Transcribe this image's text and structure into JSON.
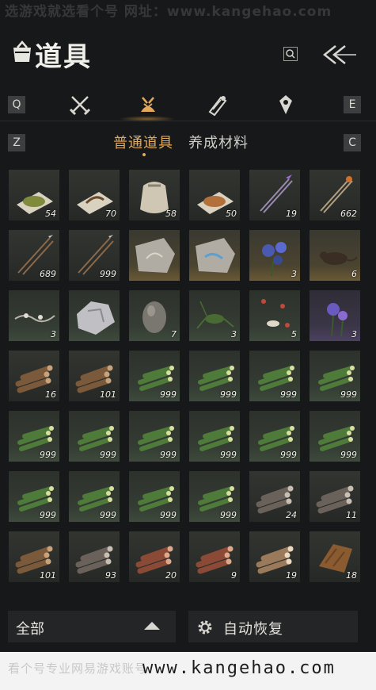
{
  "watermark_top": "选游戏就选看个号   网址：www.kangehao.com",
  "header": {
    "title": "道具"
  },
  "category_keys": {
    "left": "Q",
    "right": "E",
    "sub_left": "Z",
    "sub_right": "C"
  },
  "category_icons": [
    "crossed-swords-icon",
    "bundle-icon",
    "scroll-icon",
    "gem-icon"
  ],
  "subtabs": [
    "普通道具",
    "养成材料"
  ],
  "items": [
    {
      "kind": "herb-powder",
      "qty": "54",
      "bg": "plain"
    },
    {
      "kind": "hook-rope",
      "qty": "70",
      "bg": "plain"
    },
    {
      "kind": "sack",
      "qty": "58",
      "bg": "plain"
    },
    {
      "kind": "spice-powder",
      "qty": "50",
      "bg": "plain"
    },
    {
      "kind": "purple-arrows",
      "qty": "19",
      "bg": "plain"
    },
    {
      "kind": "fire-arrows",
      "qty": "662",
      "bg": "plain"
    },
    {
      "kind": "arrows",
      "qty": "689",
      "bg": "plain"
    },
    {
      "kind": "arrows",
      "qty": "999",
      "bg": "plain"
    },
    {
      "kind": "stone-tablet",
      "qty": "",
      "bg": "gold"
    },
    {
      "kind": "stone-blue",
      "qty": "",
      "bg": "gold"
    },
    {
      "kind": "blue-flower",
      "qty": "3",
      "bg": "gold"
    },
    {
      "kind": "rat",
      "qty": "6",
      "bg": "gold"
    },
    {
      "kind": "vine",
      "qty": "3",
      "bg": "green"
    },
    {
      "kind": "ore",
      "qty": "",
      "bg": "green"
    },
    {
      "kind": "egg-stone",
      "qty": "7",
      "bg": "green"
    },
    {
      "kind": "cricket",
      "qty": "3",
      "bg": "green"
    },
    {
      "kind": "insects",
      "qty": "5",
      "bg": "green"
    },
    {
      "kind": "purple-flower",
      "qty": "3",
      "bg": "purple"
    },
    {
      "kind": "logs-brown",
      "qty": "16",
      "bg": "plain"
    },
    {
      "kind": "logs-brown",
      "qty": "101",
      "bg": "plain"
    },
    {
      "kind": "bamboo",
      "qty": "999",
      "bg": "green"
    },
    {
      "kind": "bamboo",
      "qty": "999",
      "bg": "green"
    },
    {
      "kind": "bamboo",
      "qty": "999",
      "bg": "green"
    },
    {
      "kind": "bamboo",
      "qty": "999",
      "bg": "green"
    },
    {
      "kind": "bamboo",
      "qty": "999",
      "bg": "green"
    },
    {
      "kind": "bamboo",
      "qty": "999",
      "bg": "green"
    },
    {
      "kind": "bamboo",
      "qty": "999",
      "bg": "green"
    },
    {
      "kind": "bamboo",
      "qty": "999",
      "bg": "green"
    },
    {
      "kind": "bamboo",
      "qty": "999",
      "bg": "green"
    },
    {
      "kind": "bamboo",
      "qty": "999",
      "bg": "green"
    },
    {
      "kind": "bamboo",
      "qty": "999",
      "bg": "green"
    },
    {
      "kind": "bamboo",
      "qty": "999",
      "bg": "green"
    },
    {
      "kind": "bamboo",
      "qty": "999",
      "bg": "green"
    },
    {
      "kind": "bamboo",
      "qty": "999",
      "bg": "green"
    },
    {
      "kind": "logs-grey",
      "qty": "24",
      "bg": "plain"
    },
    {
      "kind": "logs-grey",
      "qty": "11",
      "bg": "plain"
    },
    {
      "kind": "logs-brown",
      "qty": "101",
      "bg": "plain"
    },
    {
      "kind": "logs-grey",
      "qty": "93",
      "bg": "plain"
    },
    {
      "kind": "logs-red",
      "qty": "20",
      "bg": "plain"
    },
    {
      "kind": "logs-red",
      "qty": "9",
      "bg": "plain"
    },
    {
      "kind": "logs-light",
      "qty": "19",
      "bg": "plain"
    },
    {
      "kind": "bark",
      "qty": "18",
      "bg": "plain"
    }
  ],
  "bottom": {
    "filter_label": "全部",
    "auto_label": "自动恢复"
  },
  "footer": {
    "text": "看个号专业网易游戏账号",
    "url": "www.kangehao.com"
  }
}
